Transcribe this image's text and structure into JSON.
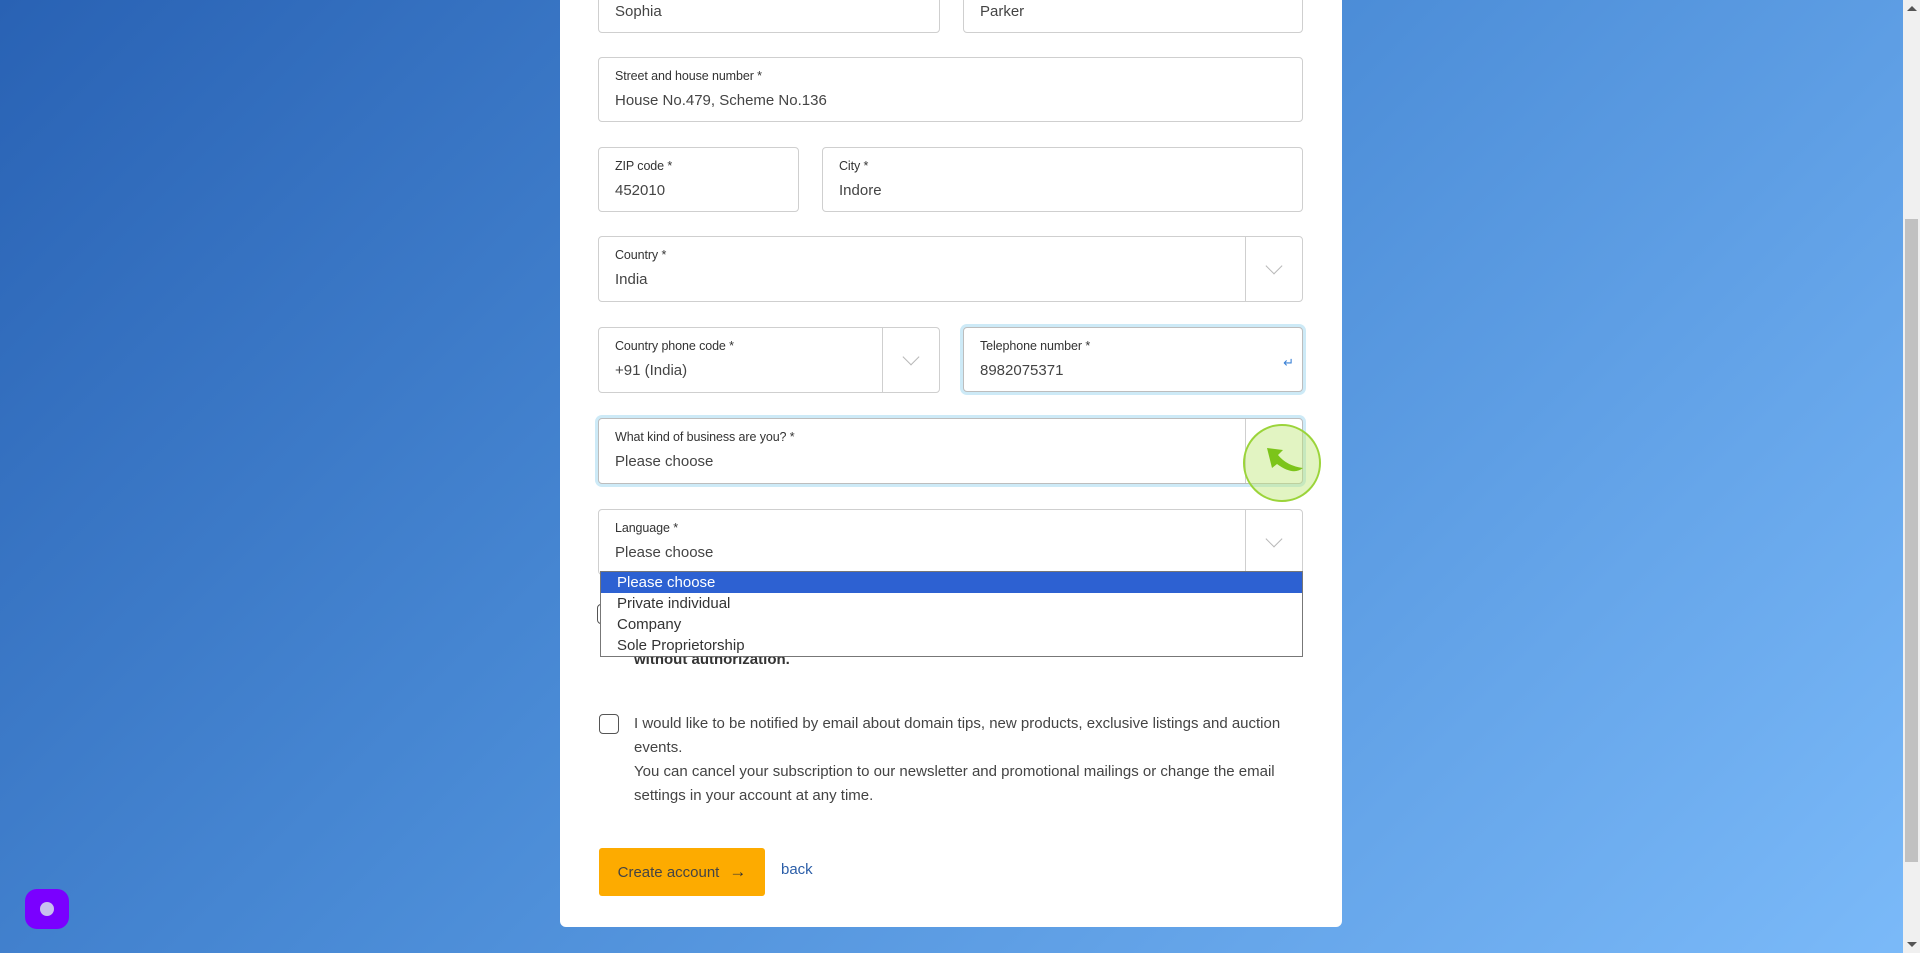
{
  "form": {
    "first_name": {
      "value": "Sophia"
    },
    "last_name": {
      "value": "Parker"
    },
    "street": {
      "label": "Street and house number *",
      "value": "House No.479, Scheme No.136"
    },
    "zip": {
      "label": "ZIP code *",
      "value": "452010"
    },
    "city": {
      "label": "City *",
      "value": "Indore"
    },
    "country": {
      "label": "Country *",
      "value": "India"
    },
    "phone_code": {
      "label": "Country phone code *",
      "value": "+91 (India)"
    },
    "telephone": {
      "label": "Telephone number *",
      "value": "8982075371",
      "icon": "enter-icon"
    },
    "business_type": {
      "label": "What kind of business are you? *",
      "value": "Please choose"
    },
    "language": {
      "label": "Language *",
      "value": "Please choose"
    }
  },
  "business_dropdown": {
    "options": [
      "Please choose",
      "Private individual",
      "Company",
      "Sole Proprietorship"
    ],
    "selected_index": 0
  },
  "consent": {
    "partial_text": "without authorization."
  },
  "newsletter": {
    "checked": false,
    "line1": "I would like to be notified by email about domain tips, new products, exclusive listings and auction events.",
    "line2": "You can cancel your subscription to our newsletter and promotional mailings or change the email settings in your account at any time."
  },
  "actions": {
    "create_account_label": "Create account",
    "create_account_arrow": "→",
    "back_label": "back"
  },
  "colors": {
    "primary_button": "#fdab00",
    "link": "#2b5ea8",
    "selected_option": "#2d61d2",
    "focus_ring": "#cdeaf7",
    "chat_widget": "#7a00ff"
  },
  "scroll": {
    "position_fraction": 0.25
  }
}
